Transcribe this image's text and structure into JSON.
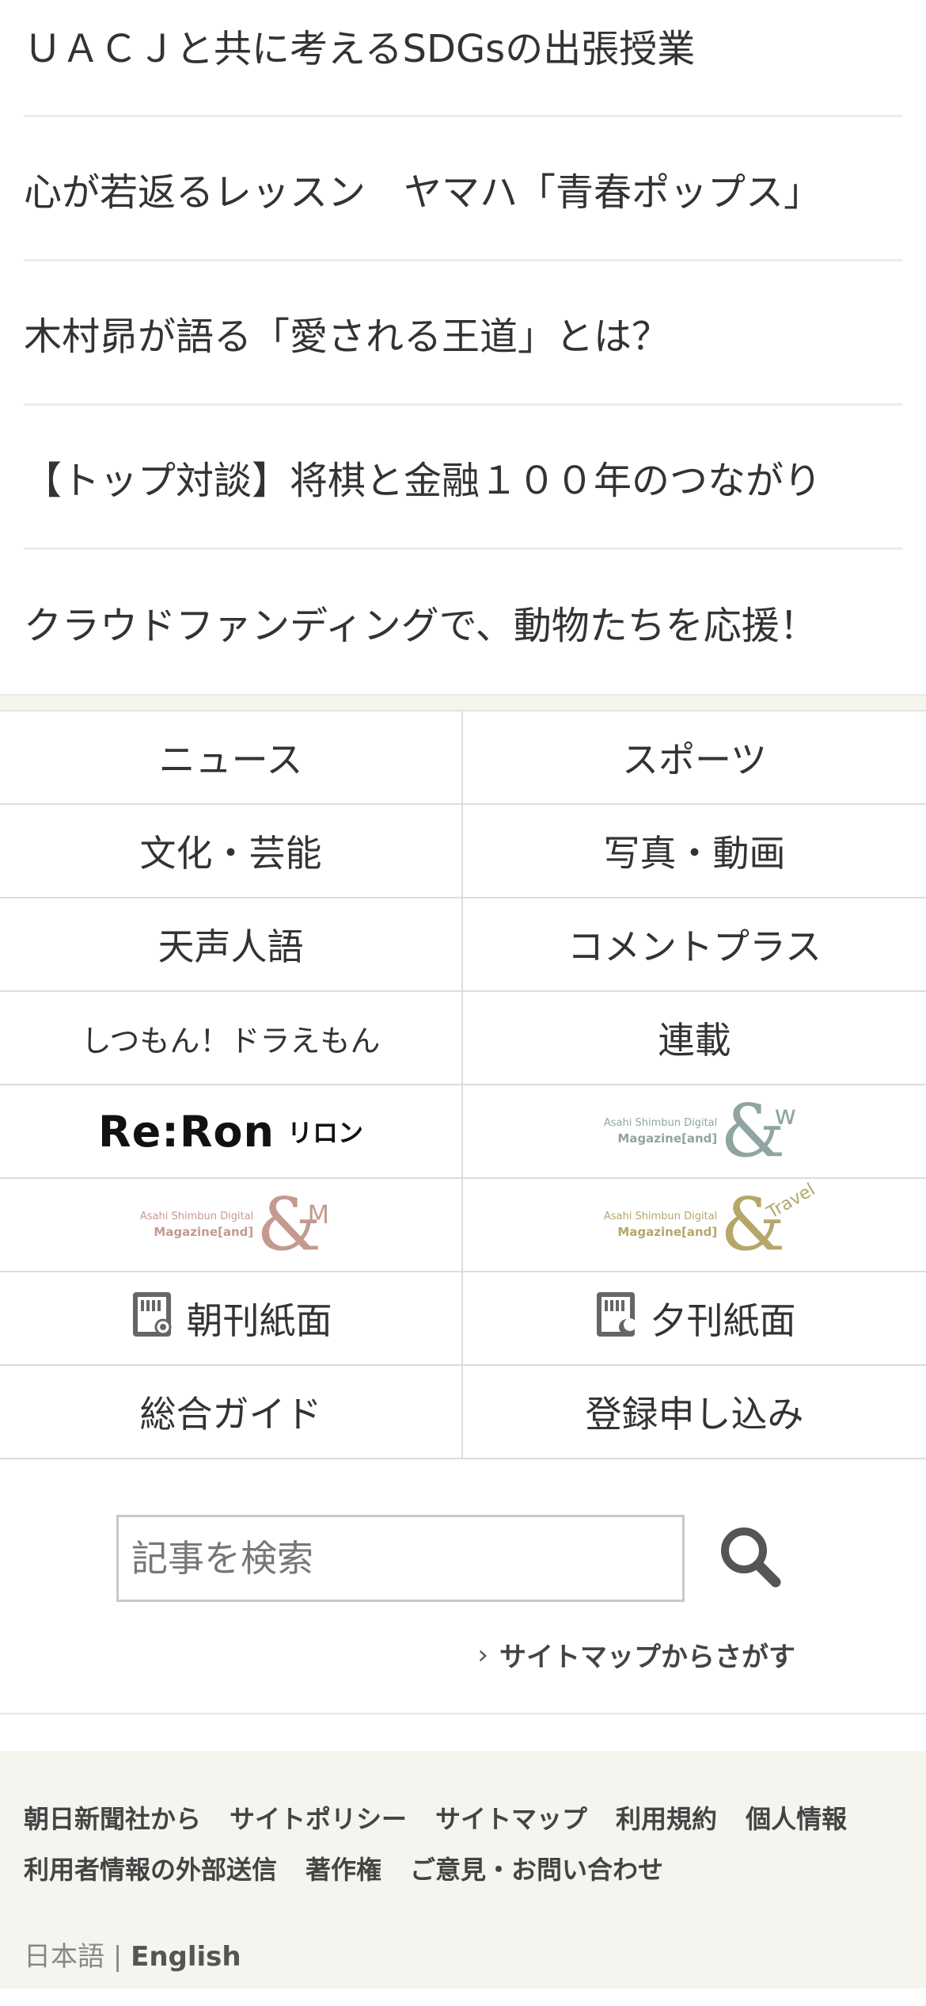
{
  "promos": [
    "ＵＡＣＪと共に考えるSDGsの出張授業",
    "心が若返るレッスン　ヤマハ「青春ポップス」",
    "木村昴が語る「愛される王道」とは？",
    "【トップ対談】将棋と金融１００年のつながり",
    "クラウドファンディングで、動物たちを応援！"
  ],
  "nav": {
    "news": "ニュース",
    "sports": "スポーツ",
    "culture": "文化・芸能",
    "photo_video": "写真・動画",
    "tensei_jingo": "天声人語",
    "comment_plus": "コメントプラス",
    "shitsumon": "しつもん！ドラえもん",
    "rensai": "連載",
    "morning_paper": "朝刊紙面",
    "evening_paper": "夕刊紙面",
    "guide": "総合ガイド",
    "register": "登録申し込み"
  },
  "logos": {
    "reron_main": "Re:Ron",
    "reron_kana": "リロン",
    "mag_line1": "Asahi Shimbun Digital",
    "mag_line2": "Magazine[and]",
    "amp": "&",
    "w_suffix": "w",
    "m_suffix": "M",
    "travel_suffix": "Travel"
  },
  "search": {
    "placeholder": "記事を検索",
    "sitemap_link": "サイトマップからさがす"
  },
  "footer": {
    "links": [
      "朝日新聞社から",
      "サイトポリシー",
      "サイトマップ",
      "利用規約",
      "個人情報",
      "利用者情報の外部送信",
      "著作権",
      "ご意見・お問い合わせ"
    ],
    "lang_ja": "日本語",
    "lang_sep": "|",
    "lang_en": "English"
  },
  "colors": {
    "w_logo": "#8fa5a2",
    "m_logo": "#c49a90",
    "travel_logo": "#b5a66a",
    "footer_bg": "#f5f4ef"
  }
}
